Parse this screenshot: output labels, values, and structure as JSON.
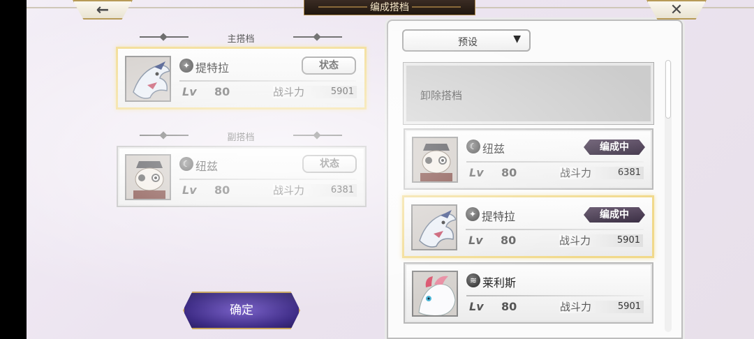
{
  "header": {
    "title": "编成搭档",
    "back_symbol": "←",
    "close_symbol": "✕"
  },
  "main_partner": {
    "section_label": "主搭档",
    "name": "提特拉",
    "element_icon": "light-element-icon",
    "status_label": "状态",
    "lv_label": "Lv",
    "level": "80",
    "power_label": "战斗力",
    "power": "5901"
  },
  "sub_partner": {
    "section_label": "副搭档",
    "name": "纽兹",
    "element_icon": "dark-element-icon",
    "status_label": "状态",
    "lv_label": "Lv",
    "level": "80",
    "power_label": "战斗力",
    "power": "6381"
  },
  "confirm_label": "确定",
  "preset": {
    "label": "预设",
    "arrow": "▼"
  },
  "remove_label": "卸除搭档",
  "list": [
    {
      "name": "纽兹",
      "badge": "编成中",
      "lv_label": "Lv",
      "level": "80",
      "power_label": "战斗力",
      "power": "6381",
      "element_icon": "dark-element-icon"
    },
    {
      "name": "提特拉",
      "badge": "编成中",
      "lv_label": "Lv",
      "level": "80",
      "power_label": "战斗力",
      "power": "5901",
      "element_icon": "light-element-icon"
    },
    {
      "name": "莱利斯",
      "badge": "",
      "lv_label": "Lv",
      "level": "80",
      "power_label": "战斗力",
      "power": "5901",
      "element_icon": "wind-element-icon"
    }
  ],
  "colors": {
    "gold_border": "#f1d98a",
    "badge_bg": "#4a3b52",
    "confirm_purple": "#5a44a8"
  }
}
